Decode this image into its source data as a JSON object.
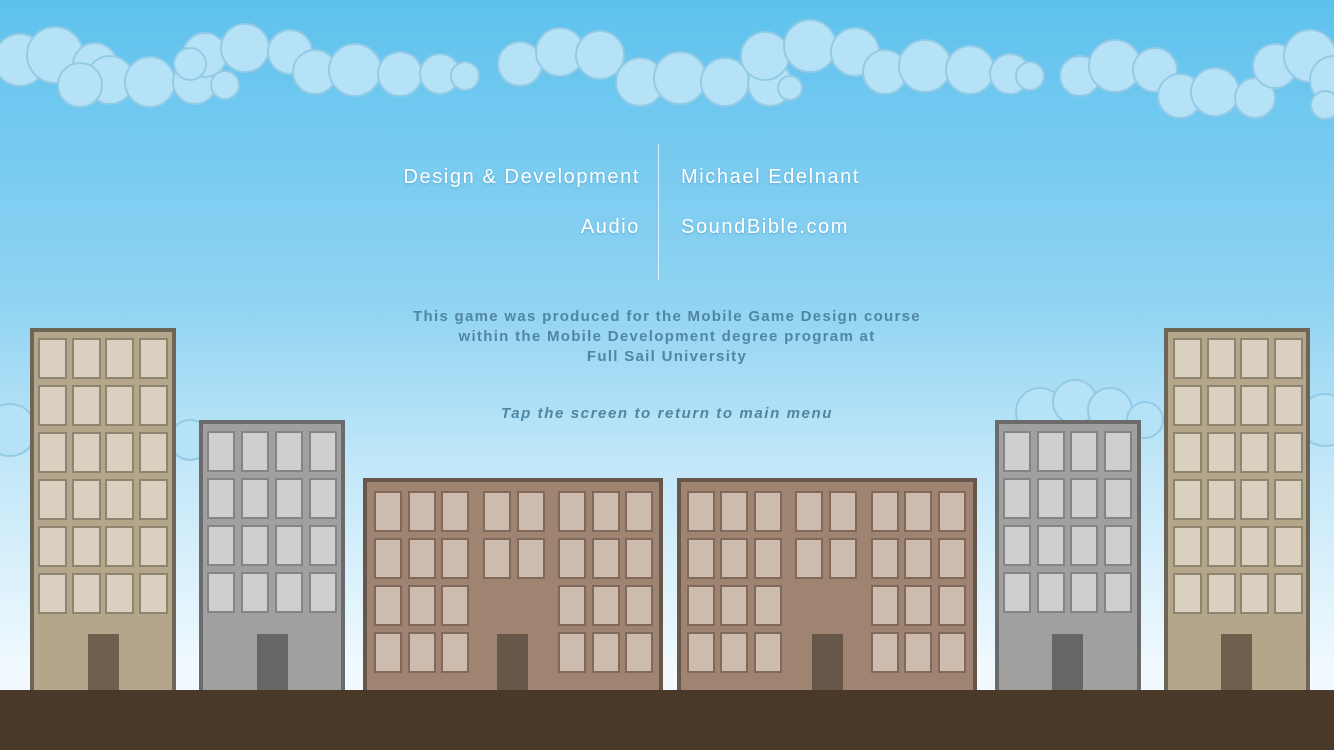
{
  "credits": [
    {
      "label": "Design & Development",
      "value": "Michael Edelnant"
    },
    {
      "label": "Audio",
      "value": "SoundBible.com"
    }
  ],
  "info_lines": [
    "This game was produced for the Mobile Game Design course",
    "within the Mobile Development degree program at",
    "Full Sail University"
  ],
  "tap_prompt": "Tap the screen to return to main menu",
  "colors": {
    "sky_top": "#5ec2ee",
    "cloud": "#b5e2f7",
    "cloud_outline": "#93cbe6",
    "text": "#ffffff",
    "info_text": "#4f86a3",
    "ground": "#4a3829",
    "tan_building": "#b3a68a",
    "gray_building": "#a0a0a0",
    "brown_building": "#9e8471"
  }
}
